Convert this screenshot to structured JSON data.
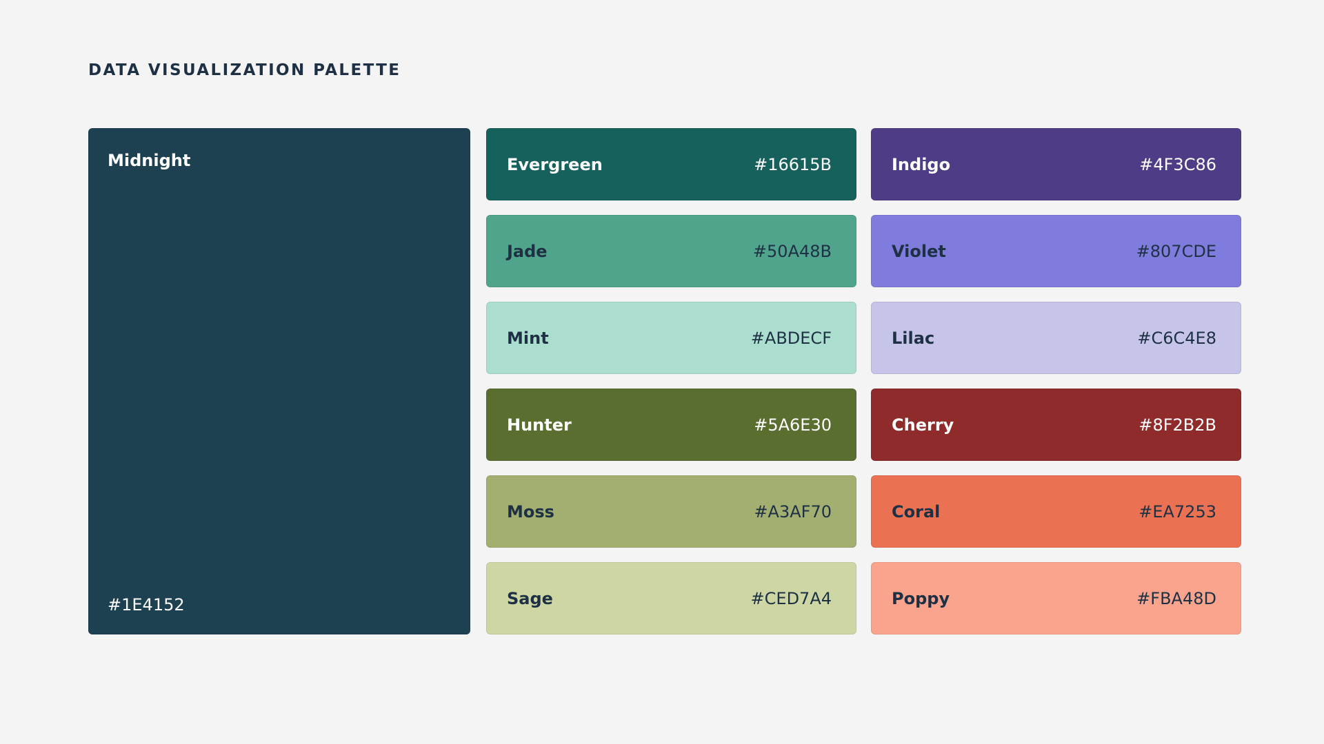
{
  "title": "DATA VISUALIZATION PALETTE",
  "feature": {
    "name": "Midnight",
    "hex": "#1E4152",
    "color": "#1E4152"
  },
  "column_a": [
    {
      "name": "Evergreen",
      "hex": "#16615B",
      "color": "#16615B",
      "text": "light"
    },
    {
      "name": "Jade",
      "hex": "#50A48B",
      "color": "#50A48B",
      "text": "dark"
    },
    {
      "name": "Mint",
      "hex": "#ABDECF",
      "color": "#ABDECF",
      "text": "dark"
    },
    {
      "name": "Hunter",
      "hex": "#5A6E30",
      "color": "#5A6E30",
      "text": "light"
    },
    {
      "name": "Moss",
      "hex": "#A3AF70",
      "color": "#A3AF70",
      "text": "dark"
    },
    {
      "name": "Sage",
      "hex": "#CED7A4",
      "color": "#CED7A4",
      "text": "dark"
    }
  ],
  "column_b": [
    {
      "name": "Indigo",
      "hex": "#4F3C86",
      "color": "#4F3C86",
      "text": "light"
    },
    {
      "name": "Violet",
      "hex": "#807CDE",
      "color": "#807CDE",
      "text": "dark"
    },
    {
      "name": "Lilac",
      "hex": "#C6C4E8",
      "color": "#C6C4E8",
      "text": "dark"
    },
    {
      "name": "Cherry",
      "hex": "#8F2B2B",
      "color": "#8F2B2B",
      "text": "light"
    },
    {
      "name": "Coral",
      "hex": "#EA7253",
      "color": "#EA7253",
      "text": "dark"
    },
    {
      "name": "Poppy",
      "hex": "#FBA48D",
      "color": "#FBA48D",
      "text": "dark"
    }
  ]
}
